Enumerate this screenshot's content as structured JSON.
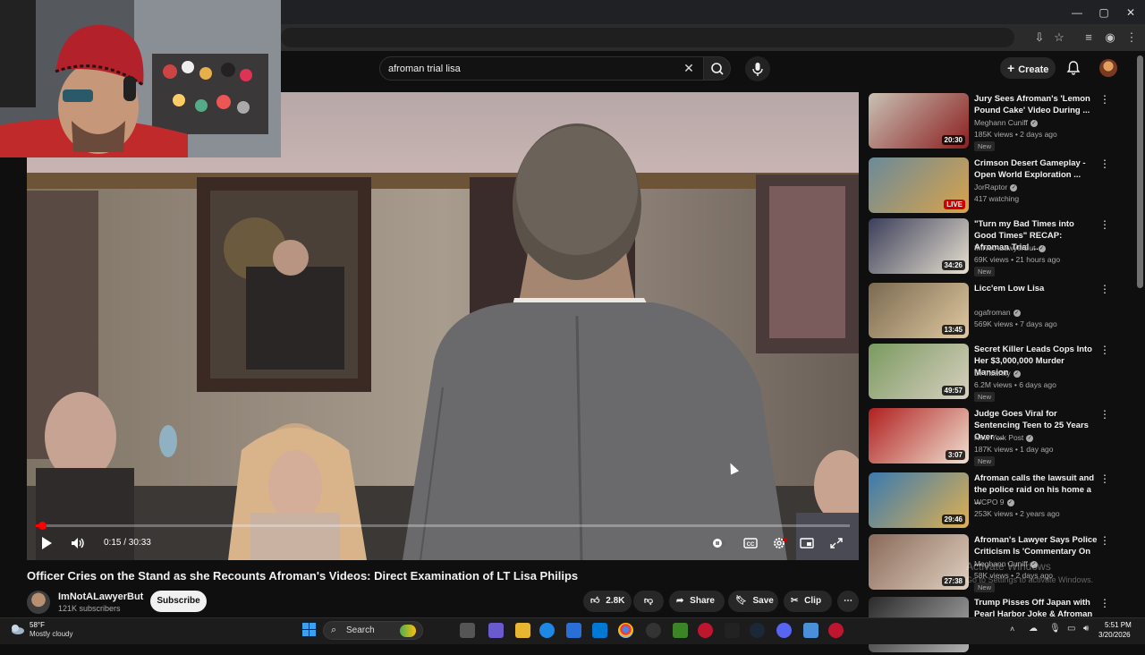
{
  "browser": {
    "window_buttons": [
      "—",
      "▢",
      "✕"
    ]
  },
  "masthead": {
    "search_value": "afroman trial lisa",
    "create_label": "Create"
  },
  "player": {
    "time": "0:15 / 30:33",
    "progress_fraction": 0.008
  },
  "video": {
    "title": "Officer Cries on the Stand as she Recounts Afroman's Videos: Direct Examination of LT Lisa Philips",
    "channel": "ImNotALawyerBut",
    "subscribers": "121K subscribers",
    "subscribe_label": "Subscribe",
    "likes": "2.8K",
    "share_label": "Share",
    "save_label": "Save",
    "clip_label": "Clip"
  },
  "recommendations": [
    {
      "title": "Jury Sees Afroman's 'Lemon Pound Cake' Video During ...",
      "channel": "Meghann Cuniff",
      "meta": "185K views • 2 days ago",
      "badge": "New",
      "duration": "20:30",
      "live": ""
    },
    {
      "title": "Crimson Desert Gameplay - Open World Exploration ...",
      "channel": "JorRaptor",
      "meta": "417 watching",
      "badge": "",
      "duration": "",
      "live": "LIVE"
    },
    {
      "title": "\"Turn my Bad Times into Good Times\" RECAP: Afroman Trial ...",
      "channel": "ImNotALawyerBut",
      "meta": "69K views • 21 hours ago",
      "badge": "New",
      "duration": "34:26",
      "live": ""
    },
    {
      "title": "Licc'em Low Lisa",
      "channel": "ogafroman",
      "meta": "569K views • 7 days ago",
      "badge": "",
      "duration": "13:45",
      "live": ""
    },
    {
      "title": "Secret Killer Leads Cops Into Her $3,000,000 Murder Mansion",
      "channel": "Dr Insanity",
      "meta": "6.2M views • 6 days ago",
      "badge": "New",
      "duration": "49:57",
      "live": ""
    },
    {
      "title": "Judge Goes Viral for Sentencing Teen to 25 Years Over ...",
      "channel": "New York Post",
      "meta": "187K views • 1 day ago",
      "badge": "New",
      "duration": "3:07",
      "live": ""
    },
    {
      "title": "Afroman calls the lawsuit and the police raid on his home a ...",
      "channel": "WCPO 9",
      "meta": "253K views • 2 years ago",
      "badge": "",
      "duration": "29:46",
      "live": ""
    },
    {
      "title": "Afroman's Lawyer Says Police Criticism Is 'Commentary On ...",
      "channel": "Meghann Cuniff",
      "meta": "58K views • 2 days ago",
      "badge": "New",
      "duration": "27:38",
      "live": ""
    },
    {
      "title": "Trump Pisses Off Japan with Pearl Harbor Joke & Afroman ...",
      "channel": "",
      "meta": "",
      "badge": "",
      "duration": "",
      "live": ""
    }
  ],
  "watermark": {
    "line1": "Activate Windows",
    "line2": "Go to Settings to activate Windows."
  },
  "taskbar": {
    "weather_temp": "58°F",
    "weather_desc": "Mostly cloudy",
    "search_label": "Search",
    "time": "5:51 PM",
    "date": "3/20/2026"
  }
}
